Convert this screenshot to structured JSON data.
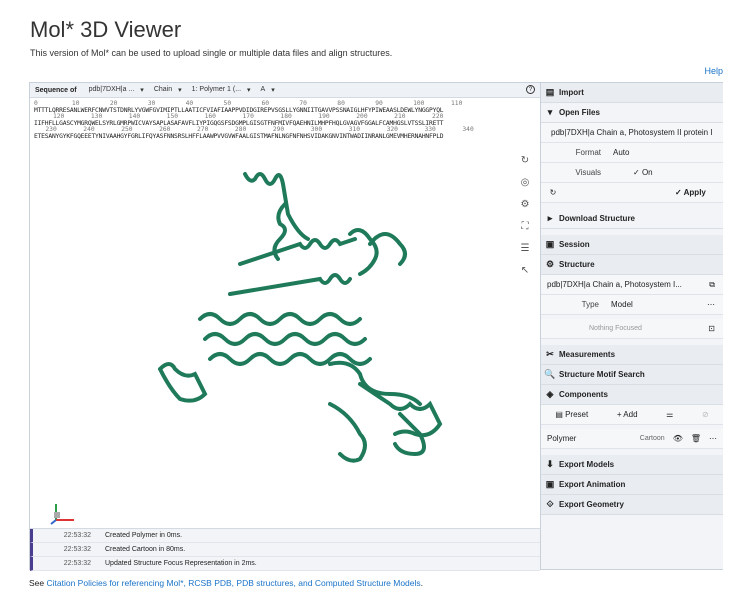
{
  "title": "Mol* 3D Viewer",
  "subtitle": "This version of Mol* can be used to upload single or multiple data files and align structures.",
  "help": "Help",
  "seq": {
    "label": "Sequence of",
    "entity": "pdb|7DXH|a ...",
    "mode": "Chain",
    "chain": "1: Polymer 1 (...",
    "chain_id": "A",
    "help_icon": "?",
    "ruler1": "0         10        20        30        40        50        60        70        80        90        100       110",
    "line1": "MTTTLQRRESANLWERFCNWVTSTDNRLYVGWFGVIMIPTLLAATICFVIAFIAAPPVDIDGIREPVSGSLLYGNNIITGAVVPSSNAIGLHFYPIWEAASLDEWLYNGGPYQL",
    "ruler2": "     120       130       140       150       160       170       180       190       200       210       220",
    "line2": "IIFHFLLGASCYMGRQWELSYRLGMRPWICVAYSAPLASAFAVFLIYPIGQGSFSDGMPLGISGTFNFMIVFQAEHNILMHPFHQLGVAGVFGGALFCAMHGSLVTSSLIRETT",
    "ruler3": "   230       240       250       260       270       280       290       300       310       320       330       340",
    "line3": "ETESANYGYKFGQEEETYNIVAAHGYFGRLIFQYASFNNSRSLHFFLAAWPVVGVWFAALGISTMAFNLNGFNFNHSVIDAKGNVINTWADIINRANLGMEVMHERNAHNFPLD"
  },
  "viewport_tools": [
    "reset-icon",
    "screenshot-icon",
    "settings-icon",
    "expand-icon",
    "selection-icon",
    "select-cursor-icon"
  ],
  "log": [
    {
      "time": "22:53:32",
      "msg": "Created Polymer in 0ms."
    },
    {
      "time": "22:53:32",
      "msg": "Created Cartoon in 80ms."
    },
    {
      "time": "22:53:32",
      "msg": "Updated Structure Focus Representation in 2ms."
    }
  ],
  "side": {
    "import": "Import",
    "open_files": "Open Files",
    "file_name": "pdb|7DXH|a Chain a, Photosystem II protein I",
    "format_k": "Format",
    "format_v": "Auto",
    "visuals_k": "Visuals",
    "visuals_v": "On",
    "apply": "Apply",
    "download": "Download Structure",
    "session": "Session",
    "structure": "Structure",
    "struct_name": "pdb|7DXH|a Chain a, Photosystem I...",
    "type_k": "Type",
    "type_v": "Model",
    "nothing": "Nothing Focused",
    "measurements": "Measurements",
    "motif": "Structure Motif Search",
    "components": "Components",
    "preset": "Preset",
    "add": "Add",
    "polymer": "Polymer",
    "cartoon": "Cartoon",
    "export_models": "Export Models",
    "export_anim": "Export Animation",
    "export_geom": "Export Geometry"
  },
  "footer": {
    "prefix": "See ",
    "link": "Citation Policies for referencing Mol*, RCSB PDB, PDB structures, and Computed Structure Models",
    "suffix": "."
  },
  "colors": {
    "cartoon": "#1f7a5a",
    "accent": "#4a3d8f",
    "link": "#1a73c9"
  }
}
